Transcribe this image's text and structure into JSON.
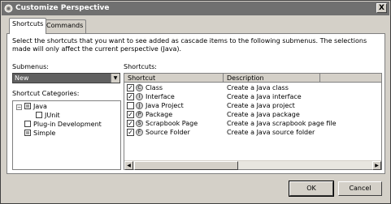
{
  "window": {
    "title": "Customize Perspective",
    "close_label": "X"
  },
  "tabs": [
    {
      "label": "Shortcuts",
      "active": true
    },
    {
      "label": "Commands",
      "active": false
    }
  ],
  "description": "Select the shortcuts that you want to see added as cascade items to the following submenus.  The selections made will only affect the current perspective (Java).",
  "submenus": {
    "label": "Submenus:",
    "selected": "New"
  },
  "categories": {
    "label": "Shortcut Categories:",
    "items": [
      {
        "label": "Java",
        "state": "partial",
        "expanded": true,
        "level": 0
      },
      {
        "label": "JUnit",
        "state": "unchecked",
        "level": 1
      },
      {
        "label": "Plug-in Development",
        "state": "unchecked",
        "level": 0
      },
      {
        "label": "Simple",
        "state": "partial",
        "level": 0
      }
    ]
  },
  "shortcuts": {
    "label": "Shortcuts:",
    "columns": [
      "Shortcut",
      "Description"
    ],
    "rows": [
      {
        "name": "Class",
        "description": "Create a Java class",
        "checked": true,
        "icon": "class-wizard-icon"
      },
      {
        "name": "Interface",
        "description": "Create a Java interface",
        "checked": true,
        "icon": "interface-wizard-icon"
      },
      {
        "name": "Java Project",
        "description": "Create a Java project",
        "checked": false,
        "icon": "project-wizard-icon"
      },
      {
        "name": "Package",
        "description": "Create a Java package",
        "checked": true,
        "icon": "package-wizard-icon"
      },
      {
        "name": "Scrapbook Page",
        "description": "Create a Java scrapbook page file",
        "checked": true,
        "icon": "scrapbook-wizard-icon"
      },
      {
        "name": "Source Folder",
        "description": "Create a Java source folder",
        "checked": true,
        "icon": "folder-wizard-icon"
      }
    ]
  },
  "buttons": {
    "ok": "OK",
    "cancel": "Cancel"
  },
  "glyphs": {
    "check": "✓",
    "minus": "−",
    "arrow_down": "▼",
    "arrow_left": "◀",
    "arrow_right": "▶"
  }
}
